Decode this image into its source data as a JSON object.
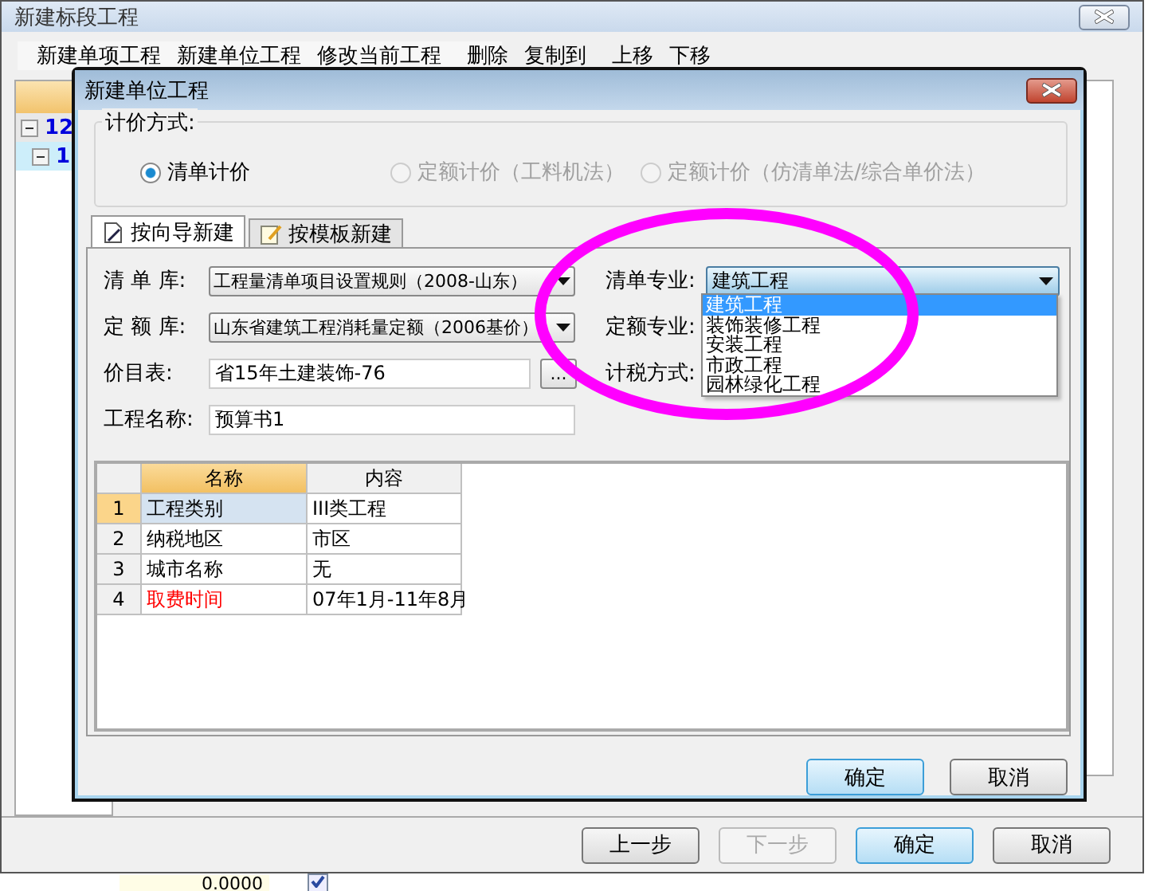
{
  "window": {
    "title": "新建标段工程"
  },
  "toolbar": [
    [
      "新建单项工程",
      "新建单位工程",
      "修改当前工程"
    ],
    [
      "删除",
      "复制到"
    ],
    [
      "上移",
      "下移"
    ]
  ],
  "tree": [
    {
      "label": "12",
      "expanded": true,
      "selected": false,
      "children": [
        {
          "label": "1",
          "expanded": true,
          "selected": true
        }
      ]
    }
  ],
  "footer_buttons": [
    {
      "label": "上一步",
      "disabled": false,
      "default": false
    },
    {
      "label": "下一步",
      "disabled": true,
      "default": false
    },
    {
      "label": "确定",
      "disabled": false,
      "default": true
    },
    {
      "label": "取消",
      "disabled": false,
      "default": false
    }
  ],
  "background_row": {
    "value": "0.0000",
    "checked": true
  },
  "dialog": {
    "title": "新建单位工程",
    "pricing": {
      "legend": "计价方式:",
      "options": [
        {
          "label": "清单计价",
          "selected": true,
          "disabled": false
        },
        {
          "label": "定额计价（工料机法）",
          "selected": false,
          "disabled": true
        },
        {
          "label": "定额计价（仿清单法/综合单价法）",
          "selected": false,
          "disabled": true
        }
      ]
    },
    "tabs": [
      {
        "label": "按向导新建",
        "selected": true,
        "kind": "wizard"
      },
      {
        "label": "按模板新建",
        "selected": false,
        "kind": "template"
      }
    ],
    "form_left": [
      {
        "label": "清 单 库:",
        "kind": "select",
        "value": "工程量清单项目设置规则（2008-山东）"
      },
      {
        "label": "定 额 库:",
        "kind": "select",
        "value": "山东省建筑工程消耗量定额（2006基价）"
      },
      {
        "label": "价目表:",
        "kind": "browse",
        "value": "省15年土建装饰-76",
        "button": "..."
      },
      {
        "label": "工程名称:",
        "kind": "input",
        "value": "预算书1"
      }
    ],
    "form_right": [
      {
        "label": "清单专业:",
        "kind": "select",
        "value": "建筑工程"
      },
      {
        "label": "定额专业:",
        "kind": "hidden"
      },
      {
        "label": "计税方式:",
        "kind": "hidden"
      }
    ],
    "dropdown": [
      {
        "label": "建筑工程",
        "selected": true
      },
      {
        "label": "装饰装修工程",
        "selected": false
      },
      {
        "label": "安装工程",
        "selected": false
      },
      {
        "label": "市政工程",
        "selected": false
      },
      {
        "label": "园林绿化工程",
        "selected": false
      }
    ],
    "table": {
      "columns": [
        "名称",
        "内容"
      ],
      "rows": [
        {
          "index": "1",
          "name": "工程类别",
          "value": "III类工程",
          "selected": true,
          "color": "#000000"
        },
        {
          "index": "2",
          "name": "纳税地区",
          "value": "市区",
          "selected": false,
          "color": "#000000"
        },
        {
          "index": "3",
          "name": "城市名称",
          "value": "无",
          "selected": false,
          "color": "#000000"
        },
        {
          "index": "4",
          "name": "取费时间",
          "value": "07年1月-11年8月",
          "selected": false,
          "color": "#ff0000"
        }
      ]
    },
    "buttons": [
      {
        "label": "确定",
        "default": true
      },
      {
        "label": "取消",
        "default": false
      }
    ]
  }
}
